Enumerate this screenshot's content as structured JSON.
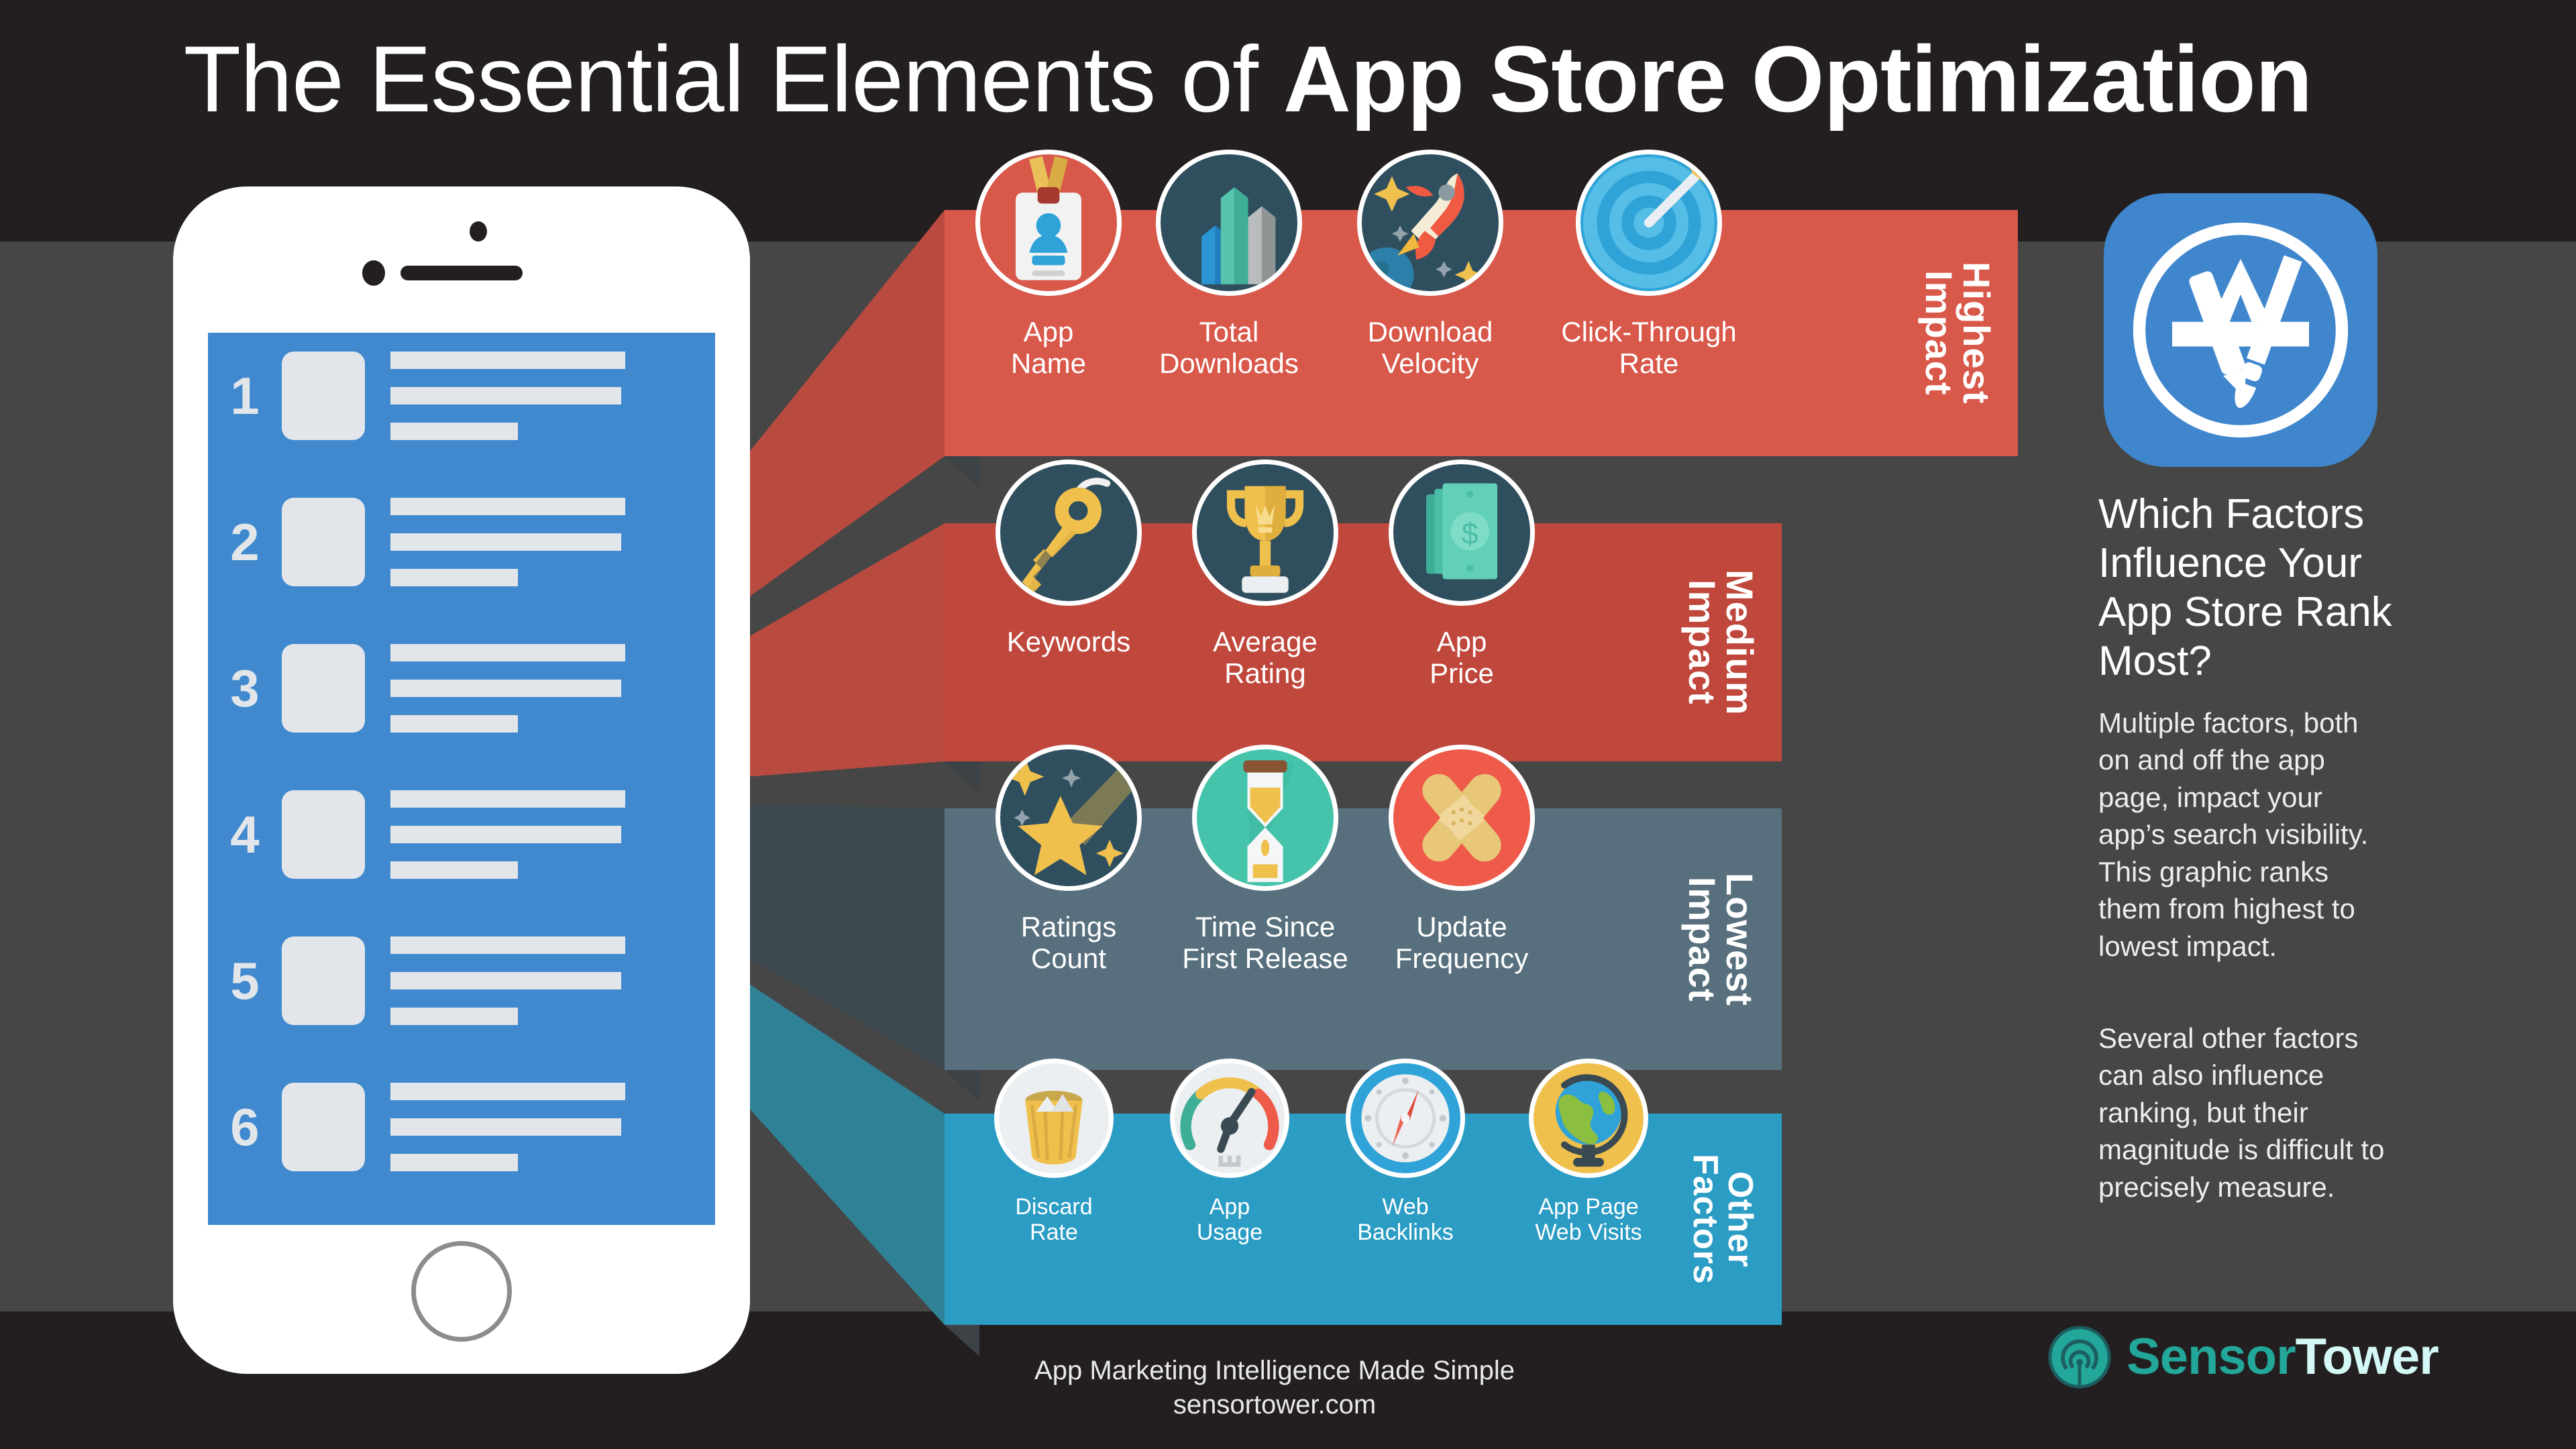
{
  "title": {
    "light": "The Essential Elements of ",
    "bold": "App Store Optimization"
  },
  "phone": {
    "rows": [
      {
        "number": "1"
      },
      {
        "number": "2"
      },
      {
        "number": "3"
      },
      {
        "number": "4"
      },
      {
        "number": "5"
      },
      {
        "number": "6"
      }
    ]
  },
  "bands": [
    {
      "label": "Highest\nImpact",
      "color": "#d8584a",
      "items": [
        {
          "name": "App\nName",
          "icon": "id-badge-icon"
        },
        {
          "name": "Total\nDownloads",
          "icon": "bar-chart-icon"
        },
        {
          "name": "Download\nVelocity",
          "icon": "rocket-icon"
        },
        {
          "name": "Click-Through\nRate",
          "icon": "target-arrow-icon"
        }
      ]
    },
    {
      "label": "Medium\nImpact",
      "color": "#c0473c",
      "items": [
        {
          "name": "Keywords",
          "icon": "key-icon"
        },
        {
          "name": "Average\nRating",
          "icon": "trophy-icon"
        },
        {
          "name": "App\nPrice",
          "icon": "money-icon"
        }
      ]
    },
    {
      "label": "Lowest\nImpact",
      "color": "#58707d",
      "items": [
        {
          "name": "Ratings\nCount",
          "icon": "shooting-star-icon"
        },
        {
          "name": "Time Since\nFirst Release",
          "icon": "hourglass-icon"
        },
        {
          "name": "Update\nFrequency",
          "icon": "bandage-icon"
        }
      ]
    },
    {
      "label": "Other\nFactors",
      "color": "#2b9cc4",
      "items": [
        {
          "name": "Discard\nRate",
          "icon": "trash-bin-icon"
        },
        {
          "name": "App\nUsage",
          "icon": "speedometer-icon"
        },
        {
          "name": "Web\nBacklinks",
          "icon": "compass-icon"
        },
        {
          "name": "App Page\nWeb Visits",
          "icon": "globe-icon"
        }
      ]
    }
  ],
  "sidebar": {
    "app_store_icon": "app-store-icon",
    "heading": "Which Factors Influence Your App Store Rank Most?",
    "paragraph1": "Multiple factors, both on and off the app page, impact your app’s search visibility. This graphic ranks them from highest to lowest impact.",
    "paragraph2": "Several other factors can also influence ranking, but their magnitude is difficult to precisely measure."
  },
  "footer": {
    "tagline": "App Marketing Intelligence Made Simple",
    "url": "sensortower.com",
    "logo_primary": "Sensor",
    "logo_secondary": "Tower",
    "logo_mark": "sensor-tower-logo-icon"
  },
  "colors": {
    "bg_dark": "#231f20",
    "bg_mid": "#464646",
    "phone_screen": "#4089ce",
    "app_store_blue": "#3f86cd",
    "logo_teal": "#22a79a"
  }
}
